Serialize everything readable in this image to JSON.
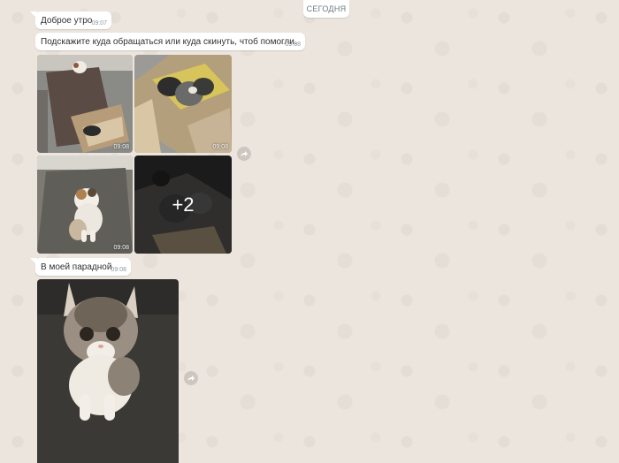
{
  "date_divider": "СЕГОДНЯ",
  "messages": [
    {
      "text": "Доброе утро",
      "time": "09:07"
    },
    {
      "text": "Подскажите куда обращаться или куда скинуть, чтоб помогли.",
      "time": "09:08"
    },
    {
      "text": "В моей парадной",
      "time": "09:08"
    }
  ],
  "album": {
    "photos": [
      {
        "time": "09:08",
        "description": "kitten on floor near box"
      },
      {
        "time": "09:08",
        "description": "kittens in cardboard box"
      },
      {
        "time": "09:08",
        "description": "kitten on mat"
      },
      {
        "more_count": "+2",
        "description": "kittens in box, dark"
      }
    ]
  },
  "single_photo": {
    "description": "tabby-white kitten close-up"
  },
  "icons": {
    "forward": "forward-arrow-icon"
  },
  "colors": {
    "background": "#ece5dd",
    "bubble": "#ffffff",
    "meta_text": "#8f989d"
  }
}
